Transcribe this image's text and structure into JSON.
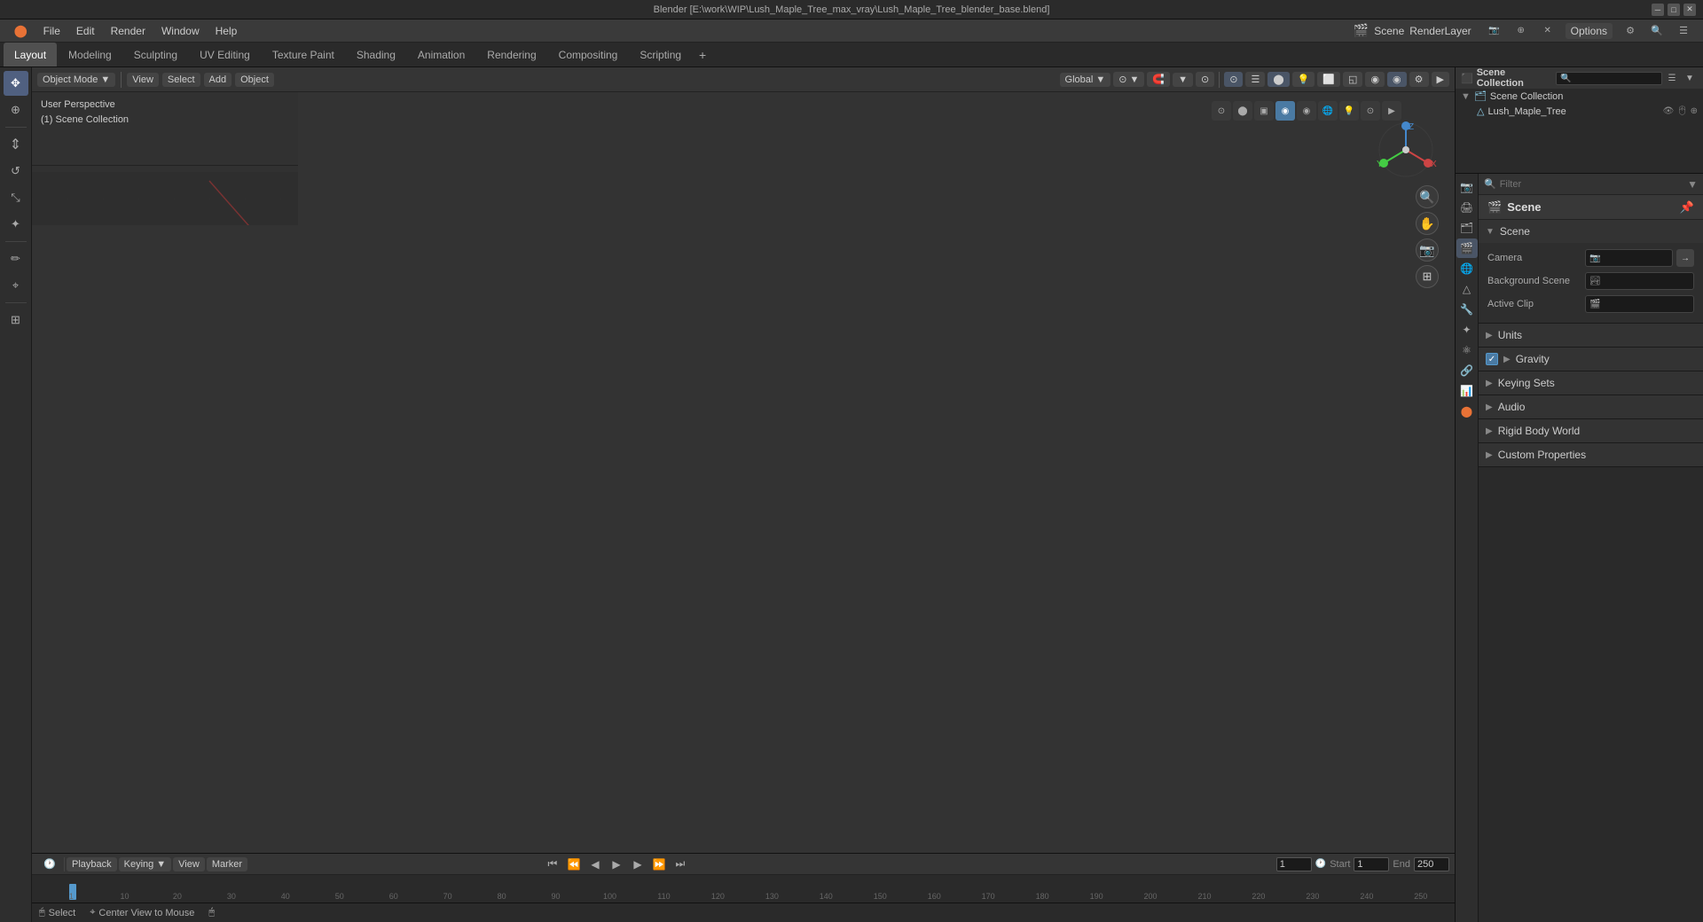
{
  "window": {
    "title": "Blender [E:\\work\\WIP\\Lush_Maple_Tree_max_vray\\Lush_Maple_Tree_blender_base.blend]"
  },
  "menu_bar": {
    "items": [
      "Blender",
      "File",
      "Edit",
      "Render",
      "Window",
      "Help"
    ]
  },
  "workspace_tabs": {
    "tabs": [
      "Layout",
      "Modeling",
      "Sculpting",
      "UV Editing",
      "Texture Paint",
      "Shading",
      "Animation",
      "Rendering",
      "Compositing",
      "Scripting"
    ],
    "active": "Layout",
    "add_label": "+"
  },
  "header": {
    "render_label": "RenderLayer",
    "options_label": "Options"
  },
  "viewport": {
    "mode_label": "Object Mode",
    "view_label": "View",
    "select_label": "Select",
    "add_label": "Add",
    "object_label": "Object",
    "breadcrumb_line1": "User Perspective",
    "breadcrumb_line2": "(1) Scene Collection",
    "global_label": "Global",
    "pivot_label": "⊙"
  },
  "left_toolbar": {
    "tools": [
      {
        "name": "select-tool",
        "icon": "✥",
        "active": true
      },
      {
        "name": "cursor-tool",
        "icon": "⊕",
        "active": false
      },
      {
        "name": "move-tool",
        "icon": "↕",
        "active": false
      },
      {
        "name": "rotate-tool",
        "icon": "↺",
        "active": false
      },
      {
        "name": "scale-tool",
        "icon": "⤢",
        "active": false
      },
      {
        "name": "transform-tool",
        "icon": "✦",
        "active": false
      },
      {
        "name": "separator1",
        "separator": true
      },
      {
        "name": "annotate-tool",
        "icon": "✏",
        "active": false
      },
      {
        "name": "measure-tool",
        "icon": "📐",
        "active": false
      },
      {
        "name": "separator2",
        "separator": true
      },
      {
        "name": "add-tool",
        "icon": "⊞",
        "active": false
      }
    ]
  },
  "gizmo_buttons": [
    {
      "name": "zoom-in",
      "icon": "🔍"
    },
    {
      "name": "zoom-out",
      "icon": "🔎"
    },
    {
      "name": "hand-pan",
      "icon": "✋"
    },
    {
      "name": "camera-view",
      "icon": "📷"
    },
    {
      "name": "grid-view",
      "icon": "⊞"
    }
  ],
  "timeline": {
    "playback_label": "Playback",
    "keying_label": "Keying",
    "view_label": "View",
    "marker_label": "Marker",
    "current_frame": "1",
    "start_frame": "1",
    "end_frame": "250",
    "start_label": "Start",
    "end_label": "End",
    "frame_numbers": [
      "1",
      "10",
      "20",
      "30",
      "40",
      "50",
      "60",
      "70",
      "80",
      "90",
      "100",
      "110",
      "120",
      "130",
      "140",
      "150",
      "160",
      "170",
      "180",
      "190",
      "200",
      "210",
      "220",
      "230",
      "240",
      "250"
    ],
    "frame_positions": [
      0,
      3.8,
      7.6,
      11.4,
      15.2,
      19.0,
      22.8,
      26.6,
      30.4,
      34.2,
      38.0,
      41.8,
      45.6,
      49.4,
      53.2,
      57.0,
      60.8,
      64.6,
      68.4,
      72.2,
      76.0,
      79.8,
      83.6,
      87.4,
      91.2,
      95.0
    ]
  },
  "status_bar": {
    "select_label": "Select",
    "center_view_label": "Center View to Mouse",
    "icon_mouse": "🖱",
    "icon_cursor": "⌖"
  },
  "outliner": {
    "title": "Scene Collection",
    "items": [
      {
        "name": "Lush_Maple_Tree",
        "type": "mesh",
        "indent": 1,
        "icon": "▲",
        "icon_right": "👁 🖱"
      },
      {
        "name": "Scene Collection",
        "type": "collection",
        "indent": 0,
        "arrow": "▶"
      }
    ]
  },
  "properties": {
    "panel_title": "Scene",
    "section_label": "Scene",
    "camera_label": "Camera",
    "camera_value": "",
    "camera_icon": "📷",
    "background_scene_label": "Background Scene",
    "background_scene_icon": "🏞",
    "active_clip_label": "Active Clip",
    "active_clip_icon": "🎬",
    "sections": [
      {
        "name": "units",
        "label": "Units",
        "expanded": false
      },
      {
        "name": "gravity",
        "label": "Gravity",
        "expanded": false,
        "checkbox": true,
        "checked": true
      },
      {
        "name": "keying-sets",
        "label": "Keying Sets",
        "expanded": false
      },
      {
        "name": "audio",
        "label": "Audio",
        "expanded": false
      },
      {
        "name": "rigid-body-world",
        "label": "Rigid Body World",
        "expanded": false
      },
      {
        "name": "custom-properties",
        "label": "Custom Properties",
        "expanded": false
      }
    ],
    "prop_tabs": [
      {
        "name": "render",
        "icon": "📷",
        "active": false
      },
      {
        "name": "output",
        "icon": "🖨",
        "active": false
      },
      {
        "name": "view-layer",
        "icon": "🗂",
        "active": false
      },
      {
        "name": "scene",
        "icon": "🎬",
        "active": true
      },
      {
        "name": "world",
        "icon": "🌐",
        "active": false
      },
      {
        "name": "object",
        "icon": "△",
        "active": false
      },
      {
        "name": "modifier",
        "icon": "🔧",
        "active": false
      },
      {
        "name": "particles",
        "icon": "✦",
        "active": false
      },
      {
        "name": "physics",
        "icon": "⚛",
        "active": false
      },
      {
        "name": "constraints",
        "icon": "🔗",
        "active": false
      },
      {
        "name": "data",
        "icon": "📊",
        "active": false
      },
      {
        "name": "material",
        "icon": "⬤",
        "active": false
      }
    ]
  },
  "top_bar": {
    "render_engine_label": "Scene",
    "render_layer_label": "RenderLayer",
    "options_label": "Options"
  }
}
